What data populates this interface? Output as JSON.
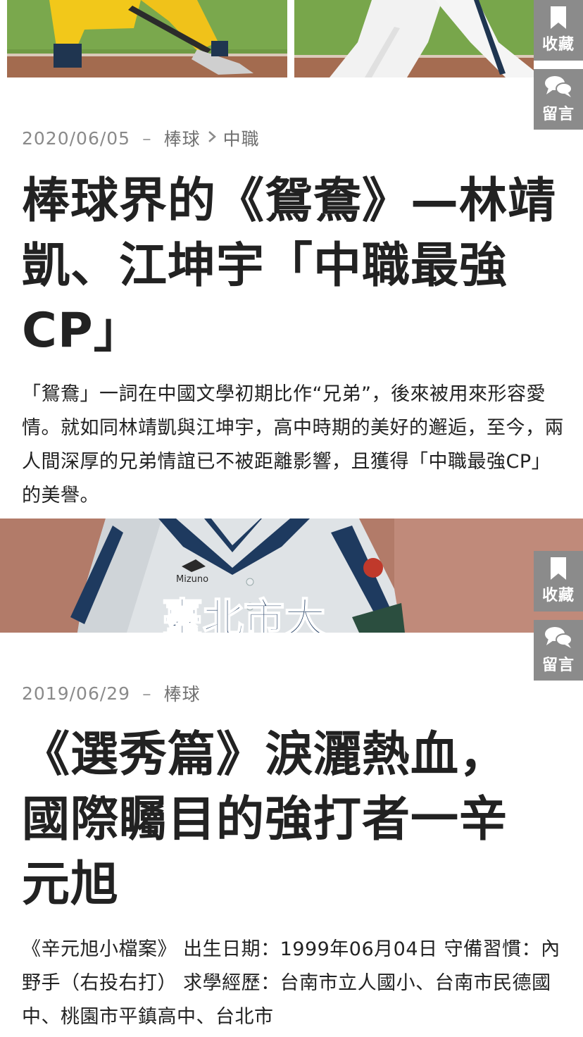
{
  "actions": {
    "bookmark_label": "收藏",
    "comment_label": "留言"
  },
  "articles": [
    {
      "date": "2020/06/05",
      "separator": "–",
      "category": "棒球",
      "subcategory": "中職",
      "title": "棒球界的《鴛鴦》—林靖凱、江坤宇「中職最強CP」",
      "excerpt": "「鴛鴦」一詞在中國文學初期比作“兄弟”，後來被用來形容愛情。就如同林靖凱與江坤宇，高中時期的美好的邂逅，至今，兩人間深厚的兄弟情誼已不被距離影響，且獲得「中職最強CP」的美譽。"
    },
    {
      "date": "2019/06/29",
      "separator": "–",
      "category": "棒球",
      "title": "《選秀篇》淚灑熱血，國際矚目的強打者一辛元旭",
      "excerpt": "《辛元旭小檔案》 出生日期：1999年06月04日 守備習慣：內野手（右投右打） 求學經歷：台南市立人國小、台南市民德國中、桃園市平鎮高中、台北市"
    }
  ],
  "photo_texts": {
    "jersey_text": "臺北市大",
    "brand_text": "Mizuno"
  }
}
